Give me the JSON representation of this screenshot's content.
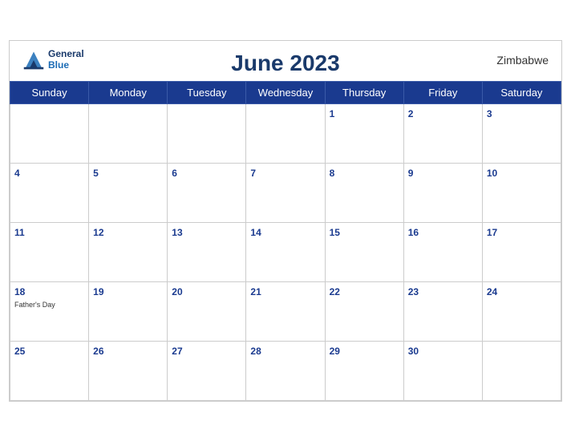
{
  "calendar": {
    "title": "June 2023",
    "country": "Zimbabwe",
    "days_of_week": [
      "Sunday",
      "Monday",
      "Tuesday",
      "Wednesday",
      "Thursday",
      "Friday",
      "Saturday"
    ],
    "weeks": [
      [
        {
          "date": "",
          "events": []
        },
        {
          "date": "",
          "events": []
        },
        {
          "date": "",
          "events": []
        },
        {
          "date": "",
          "events": []
        },
        {
          "date": "1",
          "events": []
        },
        {
          "date": "2",
          "events": []
        },
        {
          "date": "3",
          "events": []
        }
      ],
      [
        {
          "date": "4",
          "events": []
        },
        {
          "date": "5",
          "events": []
        },
        {
          "date": "6",
          "events": []
        },
        {
          "date": "7",
          "events": []
        },
        {
          "date": "8",
          "events": []
        },
        {
          "date": "9",
          "events": []
        },
        {
          "date": "10",
          "events": []
        }
      ],
      [
        {
          "date": "11",
          "events": []
        },
        {
          "date": "12",
          "events": []
        },
        {
          "date": "13",
          "events": []
        },
        {
          "date": "14",
          "events": []
        },
        {
          "date": "15",
          "events": []
        },
        {
          "date": "16",
          "events": []
        },
        {
          "date": "17",
          "events": []
        }
      ],
      [
        {
          "date": "18",
          "events": [
            "Father's Day"
          ]
        },
        {
          "date": "19",
          "events": []
        },
        {
          "date": "20",
          "events": []
        },
        {
          "date": "21",
          "events": []
        },
        {
          "date": "22",
          "events": []
        },
        {
          "date": "23",
          "events": []
        },
        {
          "date": "24",
          "events": []
        }
      ],
      [
        {
          "date": "25",
          "events": []
        },
        {
          "date": "26",
          "events": []
        },
        {
          "date": "27",
          "events": []
        },
        {
          "date": "28",
          "events": []
        },
        {
          "date": "29",
          "events": []
        },
        {
          "date": "30",
          "events": []
        },
        {
          "date": "",
          "events": []
        }
      ]
    ],
    "logo": {
      "line1": "General",
      "line2": "Blue"
    }
  }
}
